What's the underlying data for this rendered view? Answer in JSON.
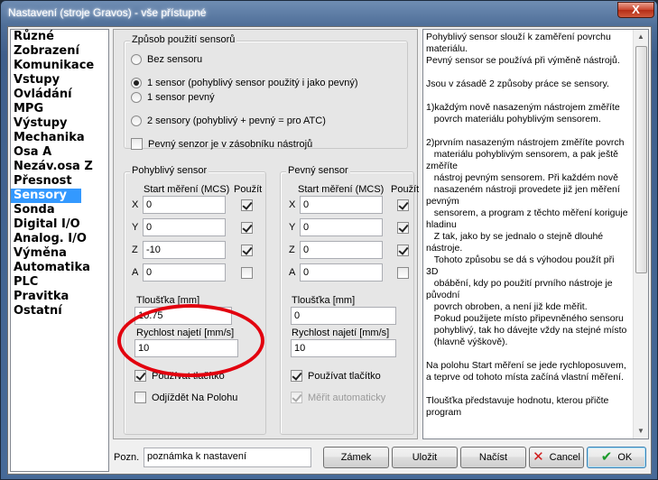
{
  "window": {
    "title": "Nastavení (stroje Gravos) - vše přístupné",
    "close_label": "X"
  },
  "sidebar": {
    "items": [
      {
        "label": "Různé"
      },
      {
        "label": "Zobrazení"
      },
      {
        "label": "Komunikace"
      },
      {
        "label": "Vstupy"
      },
      {
        "label": "Ovládání"
      },
      {
        "label": "MPG"
      },
      {
        "label": "Výstupy"
      },
      {
        "label": "Mechanika"
      },
      {
        "label": "Osa A"
      },
      {
        "label": "Nezáv.osa Z"
      },
      {
        "label": "Přesnost"
      },
      {
        "label": "Sensory"
      },
      {
        "label": "Sonda"
      },
      {
        "label": "Digital I/O"
      },
      {
        "label": "Analog. I/O"
      },
      {
        "label": "Výměna"
      },
      {
        "label": "Automatika"
      },
      {
        "label": "PLC"
      },
      {
        "label": "Pravitka"
      },
      {
        "label": "Ostatní"
      }
    ],
    "selected": "Sensory"
  },
  "usage_group": {
    "legend": "Způsob použití sensorů",
    "options": [
      {
        "label": "Bez sensoru",
        "checked": false
      },
      {
        "label": "1 sensor (pohyblivý sensor použitý i jako pevný)",
        "checked": true
      },
      {
        "label": "1 sensor pevný",
        "checked": false
      },
      {
        "label": "2 sensory (pohyblivý + pevný = pro ATC)",
        "checked": false
      }
    ],
    "magazine_checkbox": {
      "label": "Pevný senzor je v zásobníku nástrojů",
      "checked": false
    }
  },
  "movable_sensor": {
    "legend": "Pohyblivý sensor",
    "col_start": "Start měření (MCS)",
    "col_use": "Použít",
    "axes": [
      {
        "axis": "X",
        "value": "0",
        "use": true
      },
      {
        "axis": "Y",
        "value": "0",
        "use": true
      },
      {
        "axis": "Z",
        "value": "-10",
        "use": true
      },
      {
        "axis": "A",
        "value": "0",
        "use": false
      }
    ],
    "thickness_label": "Tloušťka [mm]",
    "thickness_value": "10.75",
    "speed_label": "Rychlost najetí [mm/s]",
    "speed_value": "10",
    "use_button": {
      "label": "Používat tlačítko",
      "checked": true
    },
    "go_away": {
      "label": "Odjíždět Na Polohu",
      "checked": false
    }
  },
  "fixed_sensor": {
    "legend": "Pevný sensor",
    "col_start": "Start měření (MCS)",
    "col_use": "Použít",
    "axes": [
      {
        "axis": "X",
        "value": "0",
        "use": true
      },
      {
        "axis": "Y",
        "value": "0",
        "use": true
      },
      {
        "axis": "Z",
        "value": "0",
        "use": true
      },
      {
        "axis": "A",
        "value": "0",
        "use": false
      }
    ],
    "thickness_label": "Tloušťka [mm]",
    "thickness_value": "0",
    "speed_label": "Rychlost najetí [mm/s]",
    "speed_value": "10",
    "use_button": {
      "label": "Používat tlačítko",
      "checked": true
    },
    "auto_measure": {
      "label": "Měřit automaticky",
      "checked": true
    }
  },
  "help_text": "Pohyblivý sensor slouží k zaměření povrchu\nmateriálu.\nPevný sensor se používá při výměně nástrojů.\n\nJsou v zásadě 2 způsoby práce se sensory.\n\n1)každým nově nasazeným nástrojem změříte\n   povrch materiálu pohyblivým sensorem.\n\n2)prvním nasazeným nástrojem změříte povrch\n   materiálu pohyblivým sensorem, a pak ještě\nzměříte\n   nástroj pevným sensorem. Při každém nově\n   nasazeném nástroji provedete již jen měření\npevným\n   sensorem, a program z těchto měření koriguje\nhladinu\n   Z tak, jako by se jednalo o stejně dlouhé\nnástroje.\n   Tohoto způsobu se dá s výhodou použít při\n3D\n   obábění, kdy po použití prvního nástroje je\npůvodní\n   povrch obroben, a není již kde měřit.\n   Pokud použijete místo připevněného sensoru\n   pohyblivý, tak ho dávejte vždy na stejné místo\n   (hlavně výškově).\n\nNa polohu Start měření se jede rychloposuvem,\na teprve od tohoto místa začíná vlastní měření.\n\nTloušťka představuje hodnotu, kterou přičte\nprogram",
  "bottom": {
    "note_label": "Pozn.",
    "note_value": "poznámka k nastavení",
    "lock_label": "Zámek",
    "save_label": "Uložit",
    "load_label": "Načíst",
    "cancel_label": "Cancel",
    "ok_label": "OK"
  }
}
